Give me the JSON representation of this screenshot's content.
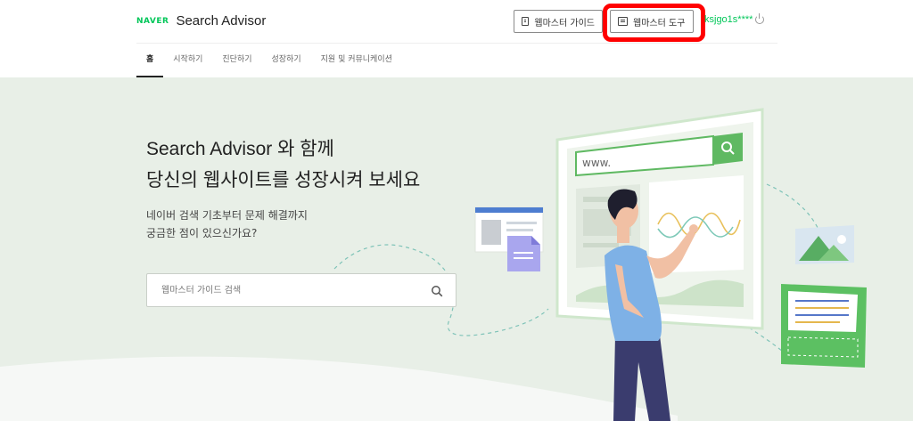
{
  "header": {
    "logo_brand": "NAVER",
    "logo_title": "Search Advisor",
    "guide_button": "웹마스터 가이드",
    "tools_button": "웹마스터 도구",
    "user_id": "ksjgo1s****"
  },
  "nav": {
    "items": [
      {
        "label": "홈"
      },
      {
        "label": "시작하기"
      },
      {
        "label": "진단하기"
      },
      {
        "label": "성장하기"
      },
      {
        "label": "지원 및 커뮤니케이션"
      }
    ]
  },
  "hero": {
    "title_line1": "Search Advisor 와 함께",
    "title_line2": "당신의 웹사이트를 성장시켜 보세요",
    "sub_line1": "네이버 검색 기초부터 문제 해결까지",
    "sub_line2": "궁금한 점이 있으신가요?",
    "search_placeholder": "웹마스터 가이드 검색",
    "browser_url": "www."
  },
  "colors": {
    "brand_green": "#03c75a",
    "hero_bg": "#e8efe7",
    "highlight_red": "#ff0000"
  }
}
